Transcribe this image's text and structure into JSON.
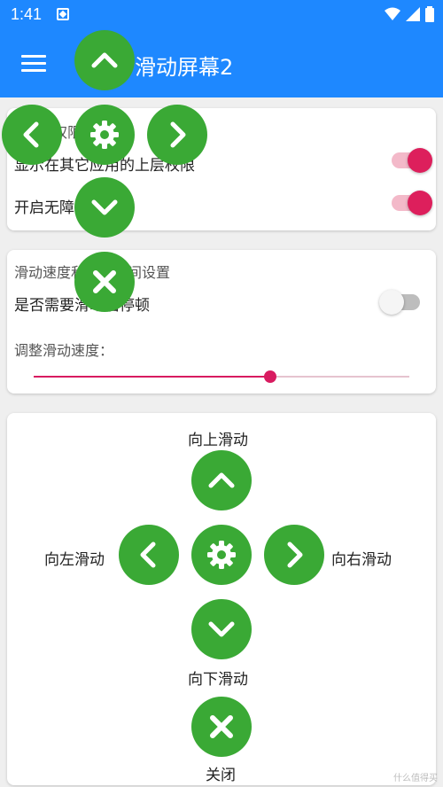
{
  "status": {
    "time": "1:41"
  },
  "appbar": {
    "title": "滑动屏幕2"
  },
  "card1": {
    "header": "权限",
    "perm_overlay": "显示在其它应用的上层权限",
    "perm_unlimited": "开启无障碍",
    "overlay_on": true,
    "unlimited_on": true
  },
  "card2": {
    "header": "滑动速度和停顿时间设置",
    "pause_label": "是否需要滑动后停顿",
    "pause_on": false,
    "speed_label": "调整滑动速度：",
    "speed_value_fraction": 0.63
  },
  "card3": {
    "up": "向上滑动",
    "left": "向左滑动",
    "right": "向右滑动",
    "down": "向下滑动",
    "close": "关闭"
  },
  "colors": {
    "primary": "#1e88ff",
    "accent": "#d81b60",
    "green": "#3aa935"
  },
  "watermark": "什么值得买"
}
